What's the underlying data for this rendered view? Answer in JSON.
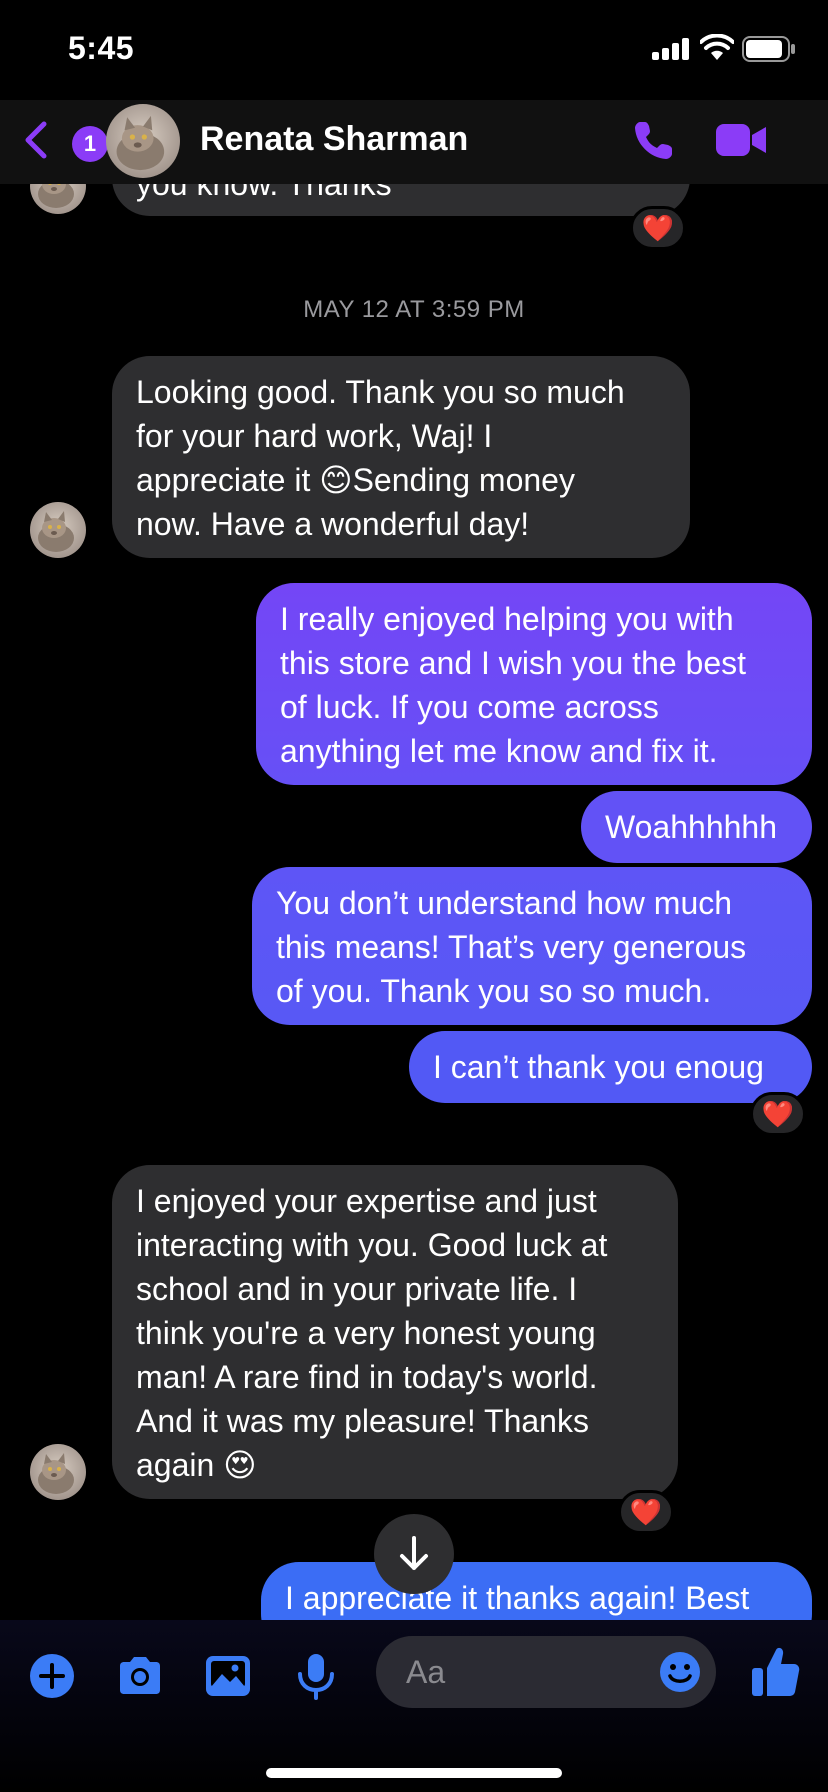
{
  "status_bar": {
    "time": "5:45"
  },
  "header": {
    "back_badge": "1",
    "contact_name": "Renata Sharman"
  },
  "messages": [
    {
      "direction": "incoming",
      "text": "you know. Thanks",
      "reaction": "❤️"
    },
    {
      "direction": "incoming",
      "text": "Looking good. Thank you so much\nfor your hard work, Waj! I\nappreciate it 😊Sending money\nnow. Have a wonderful day!"
    },
    {
      "direction": "outgoing",
      "text": "I really enjoyed helping you with\nthis store and I wish you the best\nof luck. If you come across\nanything let me know and fix it."
    },
    {
      "direction": "outgoing",
      "text": "Woahhhhhh"
    },
    {
      "direction": "outgoing",
      "text": "You don’t understand how much\nthis means! That’s very generous\nof you. Thank you so so much."
    },
    {
      "direction": "outgoing",
      "text": "I can’t thank you enoug",
      "reaction": "❤️"
    },
    {
      "direction": "incoming",
      "text": "I enjoyed your expertise and just\ninteracting with you. Good luck at\nschool and in your private life. I\nthink you're a very honest young\nman! A rare find in today's world.\nAnd it was my pleasure! Thanks\nagain 😍",
      "reaction": "❤️"
    },
    {
      "direction": "outgoing",
      "text": "I appreciate it thanks again! Best"
    }
  ],
  "timestamp": "MAY 12 AT 3:59 PM",
  "composer": {
    "placeholder": "Aa",
    "icons": [
      "plus-icon",
      "camera-icon",
      "photo-icon",
      "microphone-icon",
      "emoji-icon",
      "thumbs-up-icon"
    ]
  },
  "colors": {
    "accent": "#8b3cf7",
    "outgoing_bubble": "#6b4ff6",
    "incoming_bubble": "#2e2e30",
    "composer_icon": "#3b7cf6"
  }
}
